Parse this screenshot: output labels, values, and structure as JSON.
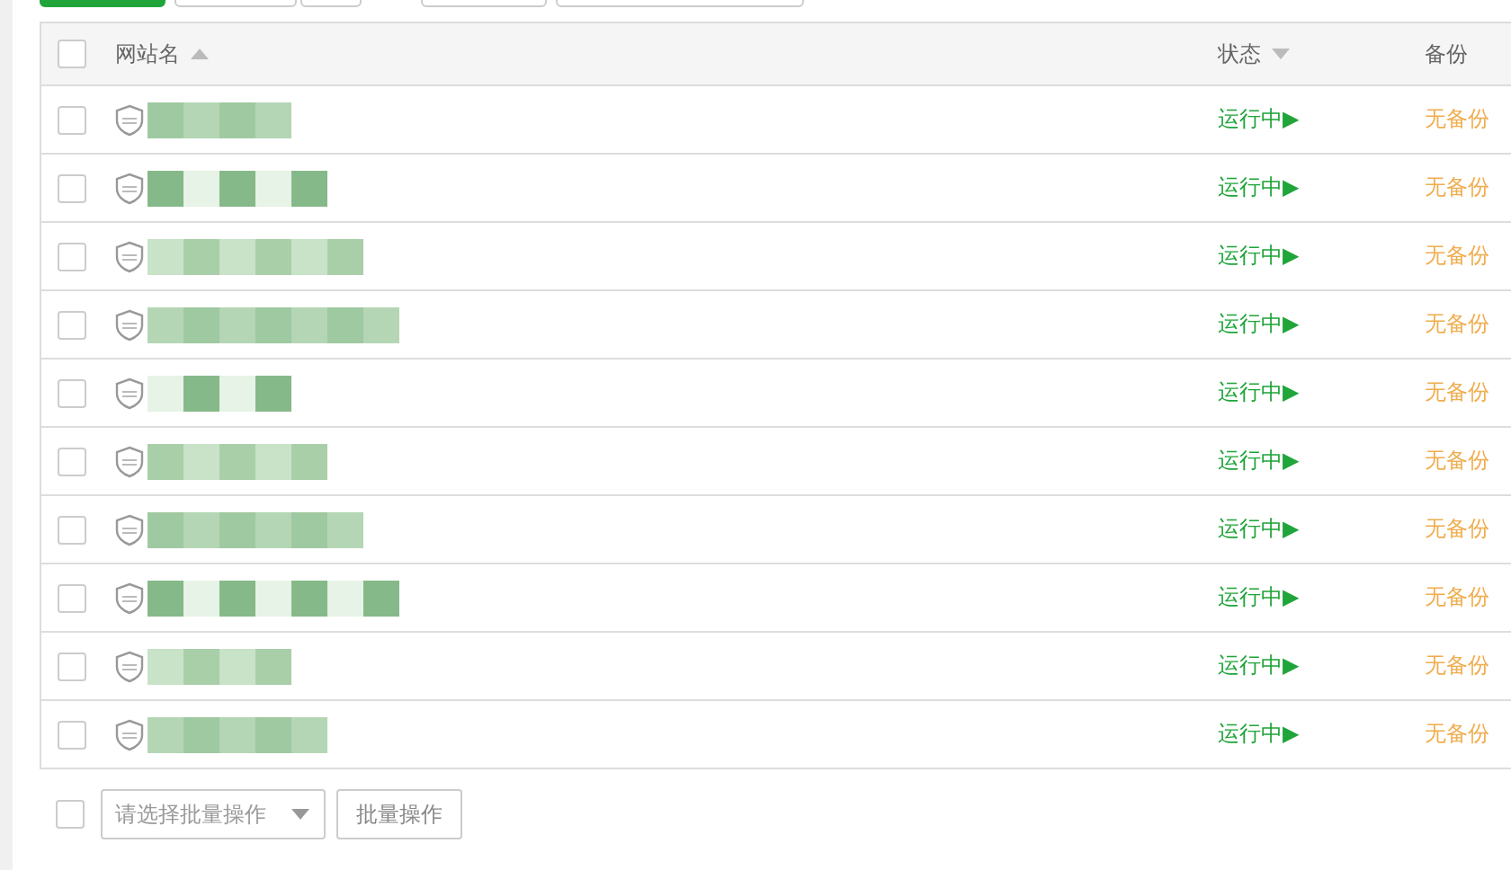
{
  "toolbar": {
    "buttons": [
      {
        "kind": "primary"
      },
      {
        "kind": "default"
      },
      {
        "kind": "default"
      },
      {
        "kind": "default"
      },
      {
        "kind": "default"
      }
    ]
  },
  "table": {
    "select_all": {
      "checked": false
    },
    "columns": [
      {
        "label": "网站名",
        "sortable": true,
        "descending": false
      },
      {
        "label": "状态",
        "sortable": true,
        "descending": true
      },
      {
        "label": "备份",
        "sortable": false
      }
    ],
    "rows": [
      {
        "checked": false,
        "status": "运行中▶",
        "backup": "无备份"
      },
      {
        "checked": false,
        "status": "运行中▶",
        "backup": "无备份"
      },
      {
        "checked": false,
        "status": "运行中▶",
        "backup": "无备份"
      },
      {
        "checked": false,
        "status": "运行中▶",
        "backup": "无备份"
      },
      {
        "checked": false,
        "status": "运行中▶",
        "backup": "无备份"
      },
      {
        "checked": false,
        "status": "运行中▶",
        "backup": "无备份"
      },
      {
        "checked": false,
        "status": "运行中▶",
        "backup": "无备份"
      },
      {
        "checked": false,
        "status": "运行中▶",
        "backup": "无备份"
      },
      {
        "checked": false,
        "status": "运行中▶",
        "backup": "无备份"
      },
      {
        "checked": false,
        "status": "运行中▶",
        "backup": "无备份"
      }
    ]
  },
  "batch": {
    "checked": false,
    "select": {
      "placeholder": "请选择批量操作"
    },
    "button": "批量操作"
  }
}
